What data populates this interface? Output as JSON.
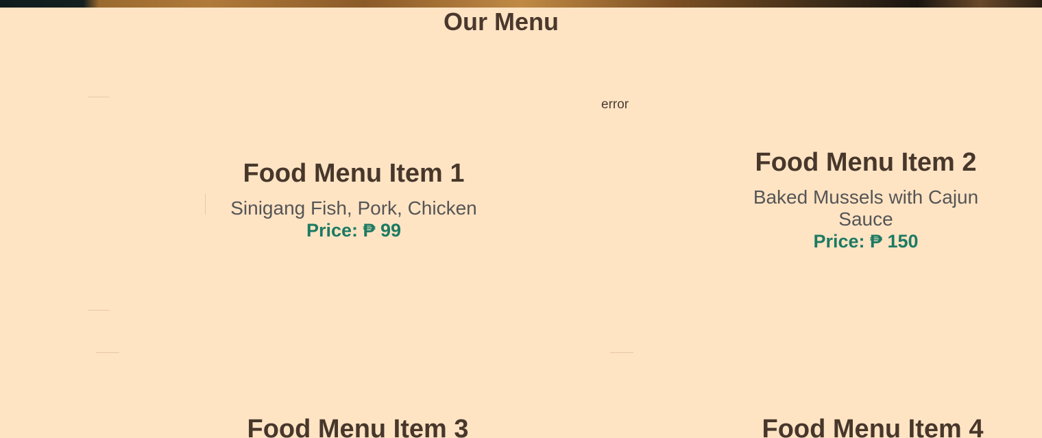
{
  "section": {
    "title": "Our Menu"
  },
  "broken_image_alt": "error",
  "items": [
    {
      "title": "Food Menu Item 1",
      "description": "Sinigang Fish, Pork, Chicken",
      "price": "Price: ₱ 99"
    },
    {
      "title": "Food Menu Item 2",
      "description": "Baked Mussels with Cajun Sauce",
      "price": "Price: ₱ 150"
    },
    {
      "title": "Food Menu Item 3"
    },
    {
      "title": "Food Menu Item 4"
    }
  ],
  "colors": {
    "background": "#ffe4c4",
    "heading": "#4a382d",
    "price": "#1c7a62",
    "description": "#555555"
  }
}
